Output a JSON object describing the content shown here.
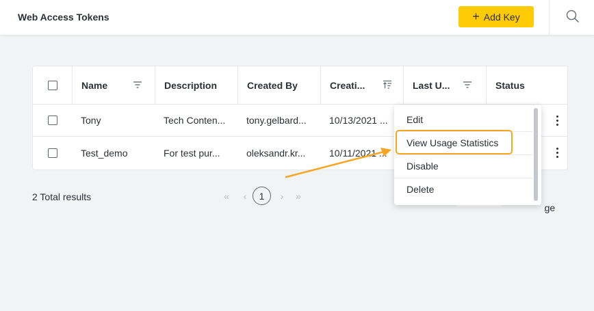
{
  "header": {
    "title": "Web Access Tokens",
    "add_key_label": "Add Key",
    "add_key_icon": "plus-icon",
    "search_icon": "search-icon",
    "accent_color": "#ffcb05"
  },
  "table": {
    "columns": {
      "name": "Name",
      "description": "Description",
      "created_by": "Created By",
      "creation": "Creati...",
      "last_used": "Last U...",
      "status": "Status"
    },
    "rows": [
      {
        "name": "Tony",
        "description": "Tech Conten...",
        "created_by": "tony.gelbard...",
        "creation": "10/13/2021 ..."
      },
      {
        "name": "Test_demo",
        "description": "For test pur...",
        "created_by": "oleksandr.kr...",
        "creation": "10/11/2021 ..."
      }
    ]
  },
  "footer": {
    "total_results": "2 Total results",
    "current_page": "1",
    "per_page_label": "In page"
  },
  "context_menu": {
    "items": {
      "edit": "Edit",
      "view_usage": "View Usage Statistics",
      "disable": "Disable",
      "delete": "Delete"
    },
    "highlight_color": "#f5a623"
  }
}
